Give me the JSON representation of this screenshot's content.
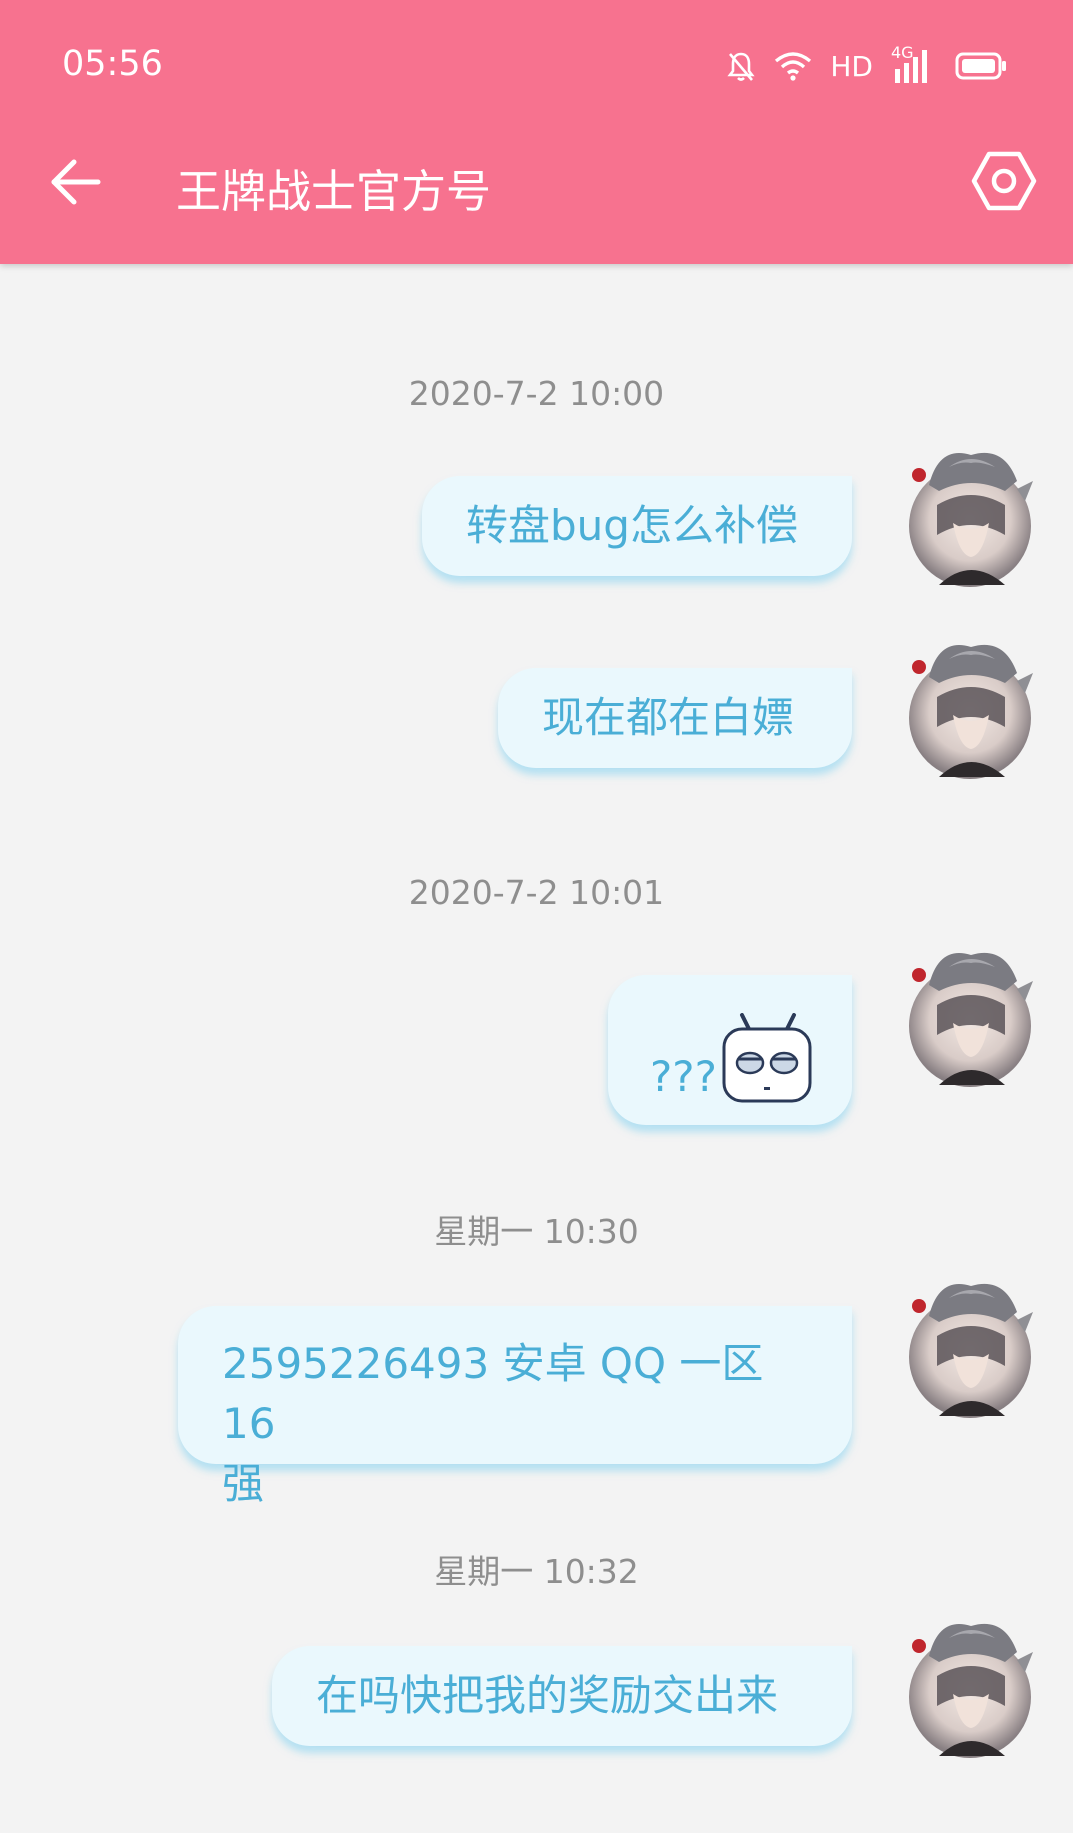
{
  "status_bar": {
    "time": "05:56",
    "network_label": "HD",
    "signal_label": "4G"
  },
  "header": {
    "title": "王牌战士官方号"
  },
  "colors": {
    "accent": "#f7728f",
    "bubble_bg": "#eaf8fd",
    "bubble_text": "#4aaed6",
    "timestamp": "#8e8e8e",
    "background": "#f3f3f3"
  },
  "icons": {
    "back": "arrow-left-icon",
    "settings": "hexagon-settings-icon",
    "mute": "bell-off-icon",
    "wifi": "wifi-icon",
    "battery": "battery-icon"
  },
  "messages": [
    {
      "type": "timestamp",
      "text": "2020-7-2 10:00"
    },
    {
      "type": "outgoing",
      "text": "转盘bug怎么补偿"
    },
    {
      "type": "outgoing",
      "text": "现在都在白嫖"
    },
    {
      "type": "timestamp",
      "text": "2020-7-2 10:01"
    },
    {
      "type": "outgoing",
      "text": "???",
      "sticker": "robot-face-sticker"
    },
    {
      "type": "timestamp",
      "text": "星期一 10:30"
    },
    {
      "type": "outgoing",
      "text_line1": "2595226493 安卓 QQ 一区 16",
      "text_line2": "强"
    },
    {
      "type": "timestamp",
      "text": "星期一 10:32"
    },
    {
      "type": "outgoing",
      "text": "在吗快把我的奖励交出来"
    }
  ]
}
